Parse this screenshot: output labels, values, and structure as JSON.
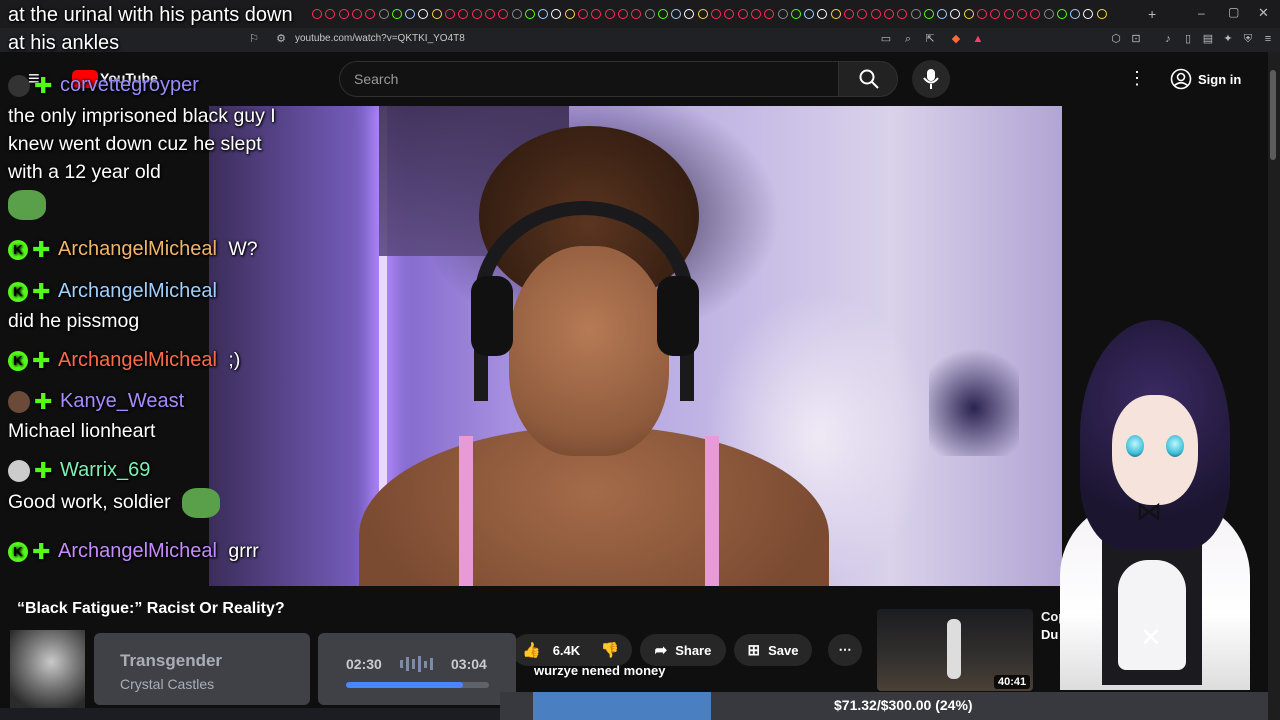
{
  "browser": {
    "url": "youtube.com/watch?v=QKTKI_YO4T8"
  },
  "youtube": {
    "logo_text": "YouTube",
    "search_placeholder": "Search",
    "signin_label": "Sign in"
  },
  "overlay_top": {
    "line1": "at the urinal with his pants down",
    "line2": "at his ankles"
  },
  "chat": [
    {
      "user": "corvettegroyper",
      "user_color": "#9b8bff",
      "text": ""
    },
    {
      "user": "",
      "text": "the only imprisoned black guy I"
    },
    {
      "user": "",
      "text": "knew went down cuz he slept"
    },
    {
      "user": "",
      "text": "with a 12 year old"
    },
    {
      "user": "ArchangelMicheal",
      "user_color": "#f0b56a",
      "text": "W?"
    },
    {
      "user": "ArchangelMicheal",
      "user_color": "#9fd0ff",
      "text": ""
    },
    {
      "user": "",
      "text": "did he pissmog"
    },
    {
      "user": "ArchangelMicheal",
      "user_color": "#ff6b4a",
      "text": ";)"
    },
    {
      "user": "Kanye_Weast",
      "user_color": "#a88bff",
      "text": ""
    },
    {
      "user": "",
      "text": "Michael lionheart"
    },
    {
      "user": "Warrix_69",
      "user_color": "#7cf0b0",
      "text": ""
    },
    {
      "user": "",
      "text": "Good work, soldier"
    },
    {
      "user": "ArchangelMicheal",
      "user_color": "#c58bff",
      "text": "grrr"
    }
  ],
  "video": {
    "title": "“Black Fatigue:” Racist Or Reality?",
    "likes": "6.4K",
    "share_label": "Share",
    "save_label": "Save"
  },
  "music": {
    "title": "Transgender",
    "artist": "Crystal Castles",
    "elapsed": "02:30",
    "total": "03:04",
    "progress_fraction": 0.82
  },
  "donation": {
    "message": "wurzye nened money",
    "goal_text": "$71.32/$300.00 (24%)",
    "goal_fraction": 0.24
  },
  "recommendation": {
    "title_fragment": "Cop",
    "title_fragment2": "Du",
    "duration": "40:41"
  },
  "colors": {
    "kick_green": "#53fc18",
    "goal_blue": "#4a7fc1",
    "music_accent": "#4a86ff"
  }
}
